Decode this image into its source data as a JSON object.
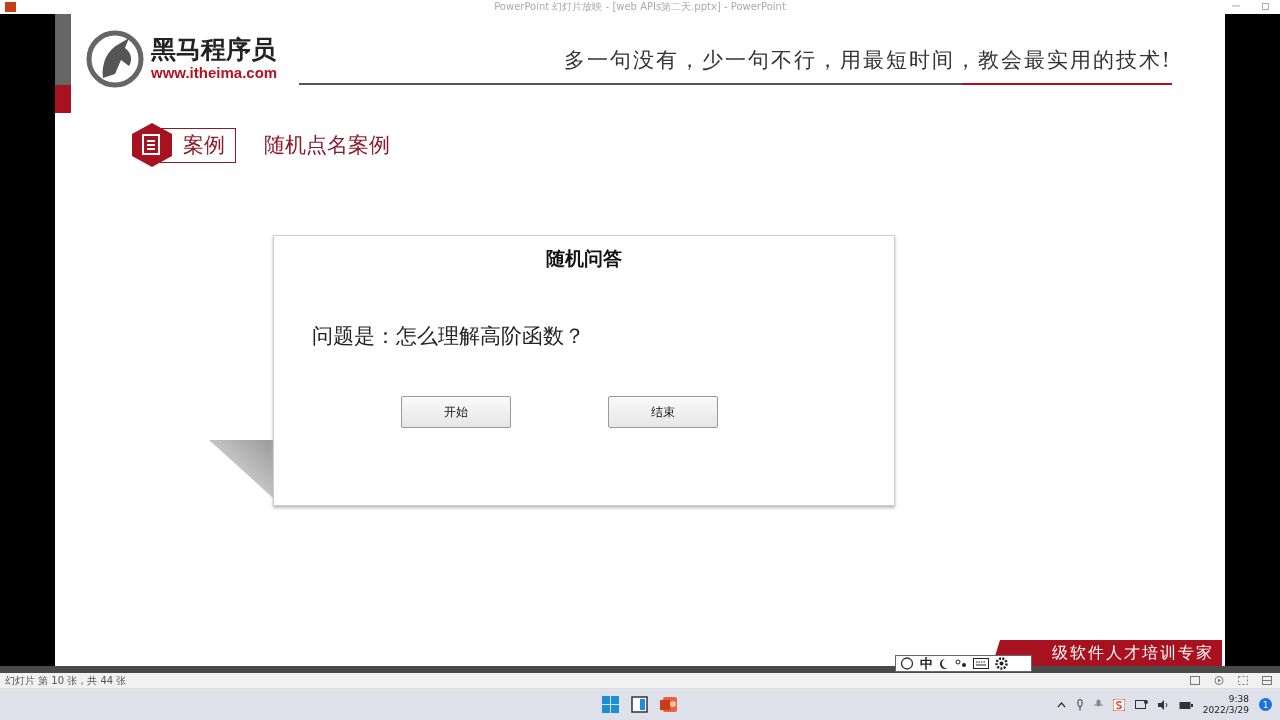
{
  "window": {
    "title": "PowerPoint 幻灯片放映 - [web APIs第二天.pptx] - PowerPoint"
  },
  "slide": {
    "brand": {
      "name": "黑马程序员",
      "url": "www.itheima.com"
    },
    "slogan": "多一句没有，少一句不行，用最短时间，教会最实用的技术!",
    "section": {
      "tag": "案例",
      "title": "随机点名案例"
    },
    "dialog": {
      "title": "随机问答",
      "question": "问题是：怎么理解高阶函数？",
      "buttons": [
        "开始",
        "结束"
      ]
    },
    "banner": "级软件人才培训专家"
  },
  "ime": {
    "mode": "中"
  },
  "status_bar": {
    "text": "幻灯片 第 10 张，共 44 张"
  },
  "taskbar": {
    "time": "9:38",
    "date": "2022/3/29",
    "notifications": "1"
  }
}
